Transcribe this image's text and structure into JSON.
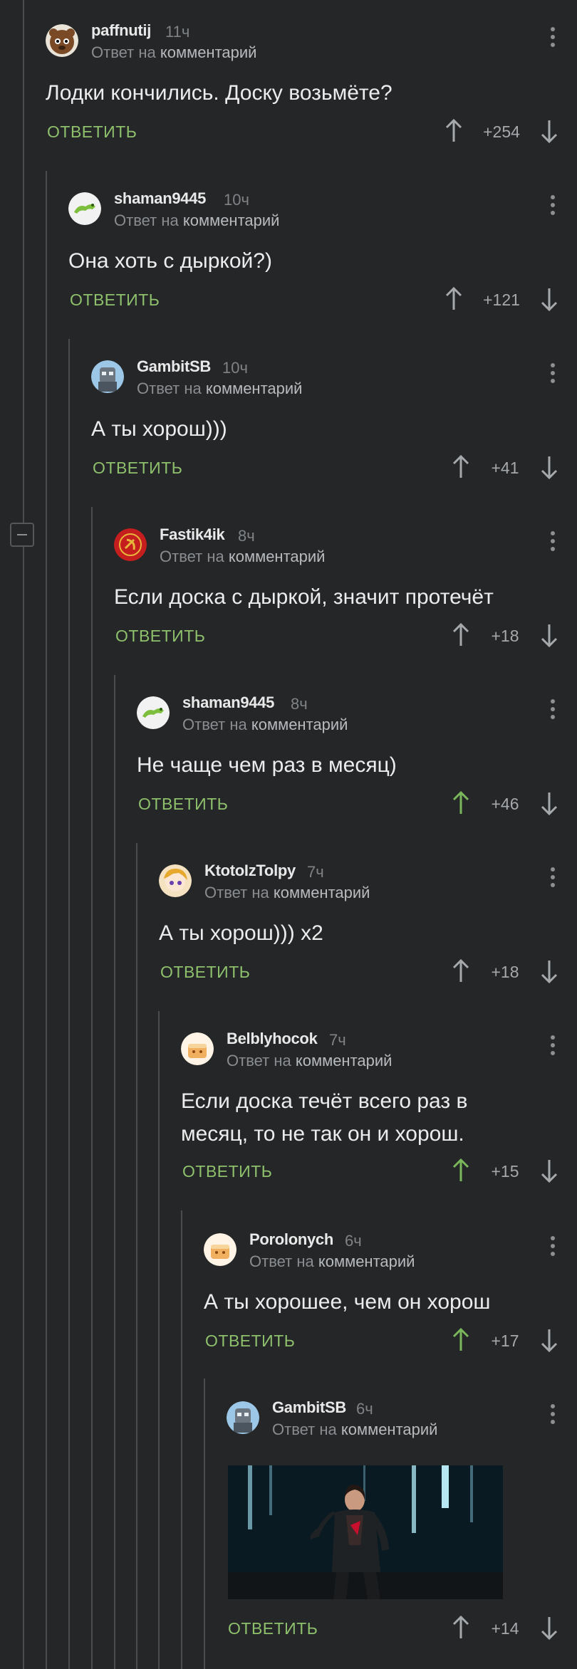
{
  "reply_prefix": "Ответ на",
  "reply_link": "комментарий",
  "reply_label": "ОТВЕТИТЬ",
  "colors": {
    "background": "#242628",
    "reply_green": "#8ec06c",
    "upvoted_green": "#7ab65a",
    "thread_line": "#4a4c4f"
  },
  "icons": {
    "more": "more-vertical-icon",
    "up": "arrow-up-icon",
    "down": "arrow-down-icon",
    "collapse": "collapse-minus-icon"
  },
  "comments": [
    {
      "username": "paffnutij",
      "time": "11ч",
      "text": "Лодки кончились. Доску возьмёте?",
      "score": "+254",
      "upvoted": false
    },
    {
      "username": "shaman9445",
      "time": "10ч",
      "text": "Она хоть с дыркой?)",
      "score": "+121",
      "upvoted": false
    },
    {
      "username": "GambitSB",
      "time": "10ч",
      "text": "А ты хорош)))",
      "score": "+41",
      "upvoted": false
    },
    {
      "username": "Fastik4ik",
      "time": "8ч",
      "text": "Если доска с дыркой, значит протечёт",
      "score": "+18",
      "upvoted": false
    },
    {
      "username": "shaman9445",
      "time": "8ч",
      "text": "Не чаще чем раз в месяц)",
      "score": "+46",
      "upvoted": true
    },
    {
      "username": "KtotoIzTolpy",
      "time": "7ч",
      "text": "А ты хорош))) x2",
      "score": "+18",
      "upvoted": false
    },
    {
      "username": "Belblyhocok",
      "time": "7ч",
      "text_lines": [
        "Если доска течёт всего раз в",
        "месяц, то не так он и хорош."
      ],
      "score": "+15",
      "upvoted": true
    },
    {
      "username": "Porolonych",
      "time": "6ч",
      "text": "А ты хорошее, чем он хорош",
      "score": "+17",
      "upvoted": true
    },
    {
      "username": "GambitSB",
      "time": "6ч",
      "score": "+14",
      "upvoted": false,
      "media": "image"
    }
  ]
}
